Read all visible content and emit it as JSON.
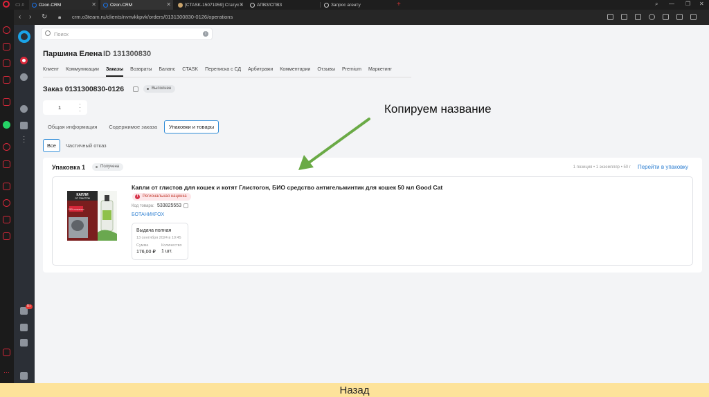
{
  "browser": {
    "tabs": [
      {
        "label": "Ozon.CRM"
      },
      {
        "label": "Ozon.CRM"
      },
      {
        "label": "[CTASK-15071959] Статус «"
      },
      {
        "label": "АПВЗ/СПВЗ"
      },
      {
        "label": "Запрос агенту"
      }
    ],
    "url": "crm.o3team.ru/clients/nvnvkkpvk/orders/0131300830-0126/operations"
  },
  "search": {
    "placeholder": "Поиск"
  },
  "client": {
    "name": "Паршина Елена",
    "id": "ID 131300830"
  },
  "nav_tabs": [
    "Клиент",
    "Коммуникации",
    "Заказы",
    "Возвраты",
    "Баланс",
    "CTASK",
    "Переписка с СД",
    "Арбитражи",
    "Комментарии",
    "Отзывы",
    "Premium",
    "Маркетинг"
  ],
  "order": {
    "title": "Заказ 0131300830-0126",
    "status": "Выполнен",
    "posting_number": "1"
  },
  "sub_tabs": [
    "Общая информация",
    "Содержимое заказа",
    "Упаковки и товары"
  ],
  "filters": [
    "Все",
    "Частичный отказ"
  ],
  "package": {
    "title": "Упаковка 1",
    "status": "Получена",
    "meta": "1 позиция • 1 экземпляр • 50 г",
    "link": "Перейти в упаковку",
    "item": {
      "name": "Капли от глистов для кошек и котят Глистогон, БИО средство антигельминтик для кошек 50 мл Good Cat",
      "badge": "Региональная наценка",
      "code_label": "Код товара:",
      "code": "533825553",
      "brand": "БОТАНИКFOX",
      "image_title": "КАПЛИ ОТ ГЛИСТОВ",
      "image_text": "100% натурально",
      "issue": {
        "title": "Выдача полная",
        "date": "13 сентября 2024 в 10:45",
        "sum_label": "Сумма",
        "qty_label": "Количество",
        "sum": "176,00 ₽",
        "qty": "1 шт."
      }
    }
  },
  "sidebar_badge": "9+",
  "annotation": "Копируем название",
  "bottom_button": "Назад",
  "colors": {
    "accent": "#2e8bd7",
    "arrow": "#6aaa46",
    "bottom_bar": "#fde39a",
    "opera": "#d8283a"
  }
}
